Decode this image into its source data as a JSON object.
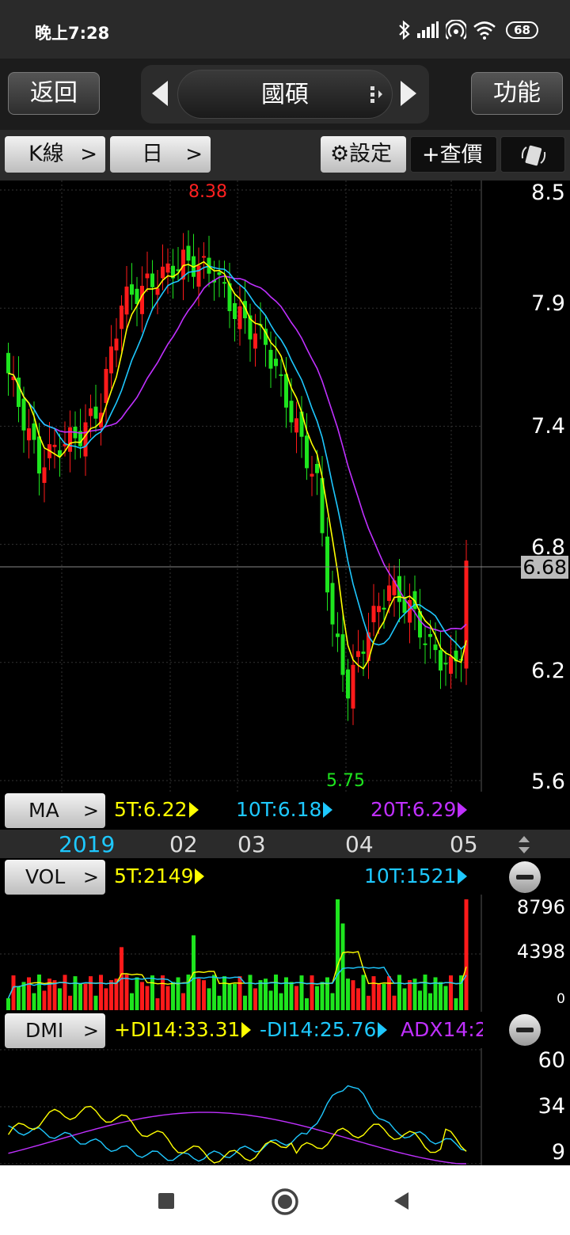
{
  "status": {
    "time": "晚上7:28",
    "battery": "68"
  },
  "header": {
    "back_label": "返回",
    "stock_name": "國碩",
    "func_label": "功能"
  },
  "toolbar": {
    "kline_label": "K線",
    "period_label": "日",
    "settings_label": "設定",
    "quote_label": "+查價"
  },
  "price_axis": [
    "8.5",
    "7.9",
    "7.4",
    "6.8",
    "6.2",
    "5.6"
  ],
  "main": {
    "current_price": "6.68",
    "high_label": "8.38",
    "low_label": "5.75"
  },
  "ma": {
    "button": "MA",
    "ma5": "5T:6.22",
    "ma10": "10T:6.18",
    "ma20": "20T:6.29"
  },
  "date_axis": [
    "2019",
    "02",
    "03",
    "04",
    "05"
  ],
  "vol": {
    "button": "VOL",
    "ma5": "5T:2149",
    "ma10": "10T:1521",
    "axis": [
      "8796",
      "4398",
      "0"
    ]
  },
  "dmi": {
    "button": "DMI",
    "pdi": "+DI14:33.31",
    "mdi": "-DI14:25.76",
    "adx": "ADX14:2",
    "axis": [
      "60",
      "34",
      "9"
    ]
  },
  "colors": {
    "up": "#ff1a1a",
    "down": "#1ee51e",
    "ma5": "#ffff00",
    "ma10": "#1ec8ff",
    "ma20": "#c030ff",
    "date": "#1ec8ff"
  }
}
